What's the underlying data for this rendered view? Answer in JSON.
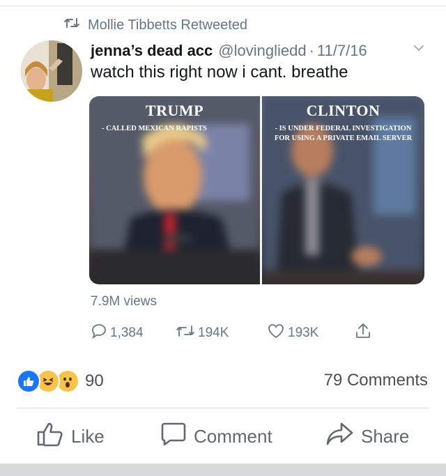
{
  "retweet": {
    "label": "Mollie Tibbetts Retweeted"
  },
  "tweet": {
    "display_name": "jenna’s dead acc",
    "handle": "@lovingliedd",
    "separator": "·",
    "date": "11/7/16",
    "text": "watch this right now i cant. breathe",
    "views": "7.9M views"
  },
  "media": {
    "left_title": "TRUMP",
    "left_subtitle": "- CALLED MEXICAN RAPISTS",
    "right_title": "CLINTON",
    "right_subtitle": "- IS UNDER FEDERAL INVESTIGATION FOR USING A PRIVATE EMAIL SERVER"
  },
  "tweet_actions": {
    "replies": "1,384",
    "retweets": "194K",
    "likes": "193K"
  },
  "fb": {
    "reaction_count": "90",
    "comments": "79 Comments",
    "like_label": "Like",
    "comment_label": "Comment",
    "share_label": "Share"
  },
  "colors": {
    "fb_like_blue": "#1877f2",
    "reaction_yellow": "#f7c34a",
    "twitter_gray": "#657786"
  },
  "icons": [
    "retweet-icon",
    "chevron-down-icon",
    "reply-icon",
    "heart-icon",
    "share-up-icon",
    "thumbs-up-icon",
    "comment-bubble-icon",
    "share-arrow-icon"
  ]
}
